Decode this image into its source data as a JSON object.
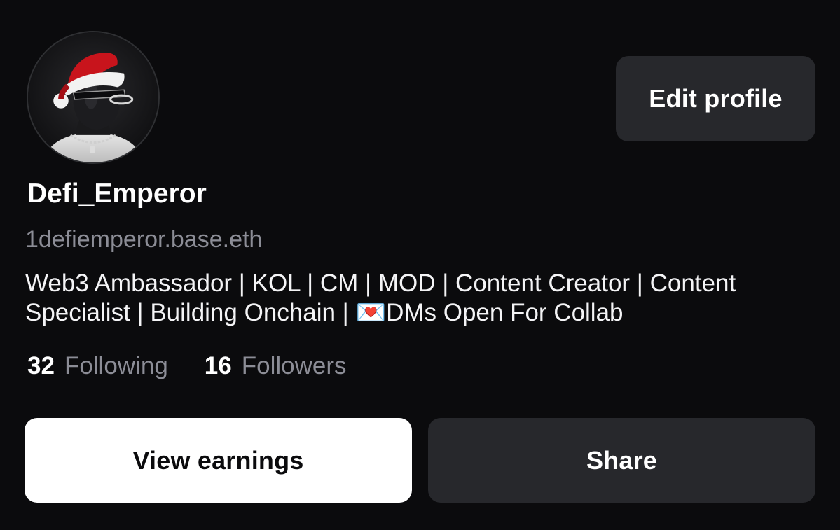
{
  "profile": {
    "display_name": "Defi_Emperor",
    "handle": "1defiemperor.base.eth",
    "bio": "Web3 Ambassador | KOL | CM | MOD | Content Creator | Content Specialist | Building Onchain | 💌DMs Open For Collab",
    "avatar_icon": "masked-figure-santa-hat-avatar"
  },
  "stats": {
    "following_count": "32",
    "following_label": "Following",
    "followers_count": "16",
    "followers_label": "Followers"
  },
  "actions": {
    "edit_profile_label": "Edit profile",
    "view_earnings_label": "View earnings",
    "share_label": "Share"
  },
  "colors": {
    "background": "#0b0b0d",
    "secondary_button": "#27282c",
    "primary_button": "#ffffff",
    "muted_text": "#8c8d96"
  }
}
